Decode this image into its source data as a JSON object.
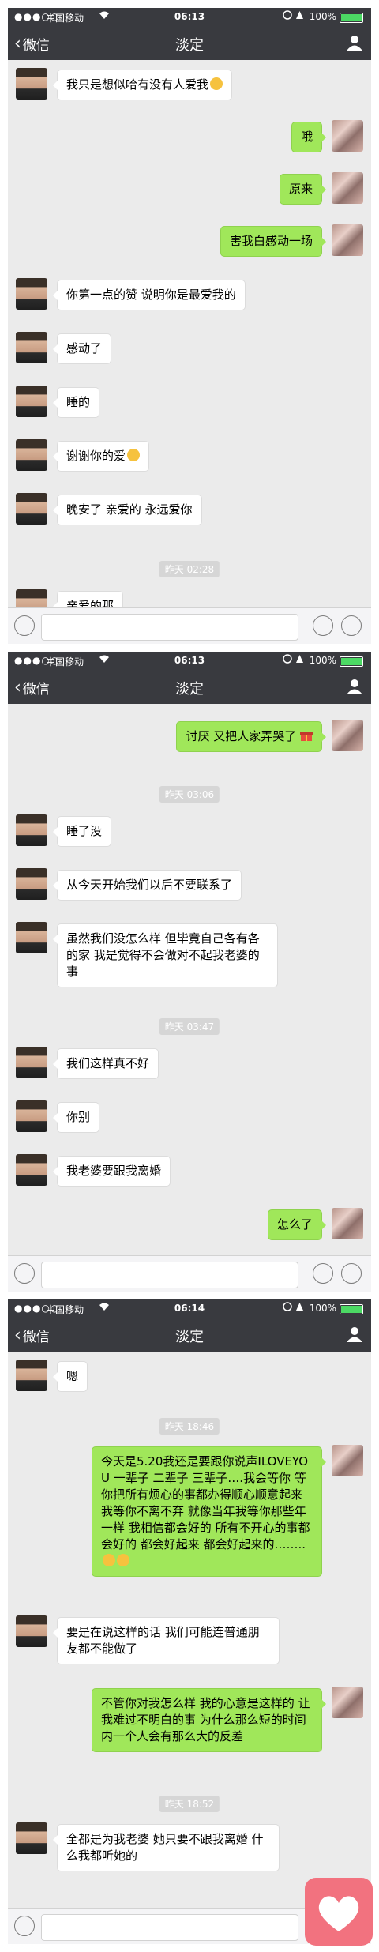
{
  "status": {
    "carrier": "中国移动",
    "battery": "100%",
    "signal_dots": "●●●○○"
  },
  "nav": {
    "back_label": "微信",
    "title": "淡定"
  },
  "panels": [
    {
      "time": "06:13",
      "messages": [
        {
          "side": "left",
          "text": "我只是想似哈有没有人爱我",
          "emoji": true
        },
        {
          "side": "right",
          "text": "哦"
        },
        {
          "side": "right",
          "text": "原来"
        },
        {
          "side": "right",
          "text": "害我白感动一场"
        },
        {
          "side": "left",
          "text": "你第一点的赞 说明你是最爱我的"
        },
        {
          "side": "left",
          "text": "感动了"
        },
        {
          "side": "left",
          "text": "睡的"
        },
        {
          "side": "left",
          "text": "谢谢你的爱",
          "emoji": true
        },
        {
          "side": "left",
          "text": "晚安了 亲爱的 永远爱你"
        }
      ],
      "timestamp": "昨天 02:28",
      "partial_message": "亲爱的那"
    },
    {
      "time": "06:13",
      "messages_a": [
        {
          "side": "right",
          "text": "讨厌 又把人家弄哭了",
          "gift": true
        }
      ],
      "timestamp_1": "昨天 03:06",
      "messages_b": [
        {
          "side": "left",
          "text": "睡了没"
        },
        {
          "side": "left",
          "text": "从今天开始我们以后不要联系了"
        },
        {
          "side": "left",
          "text": "虽然我们没怎么样 但毕竟自己各有各的家 我是觉得不会做对不起我老婆的事"
        }
      ],
      "timestamp_2": "昨天 03:47",
      "messages_c": [
        {
          "side": "left",
          "text": "我们这样真不好"
        },
        {
          "side": "left",
          "text": "你别"
        },
        {
          "side": "left",
          "text": "我老婆要跟我离婚"
        },
        {
          "side": "right",
          "text": "怎么了"
        }
      ]
    },
    {
      "time": "06:14",
      "messages_a": [
        {
          "side": "left",
          "text": "嗯"
        }
      ],
      "timestamp_1": "昨天 18:46",
      "messages_b": [
        {
          "side": "right",
          "text": "今天是5.20我还是要跟你说声ILOVEYOU 一辈子 二辈子 三辈子….我会等你 等你把所有烦心的事都办得顺心顺意起来 我等你不离不弃 就像当年我等你那些年一样 我相信都会好的 所有不开心的事都会好的 都会好起来 都会好起来的……..",
          "emoji2": true
        },
        {
          "side": "left",
          "text": "要是在说这样的话 我们可能连普通朋友都不能做了"
        },
        {
          "side": "right",
          "text": "不管你对我怎么样 我的心意是这样的 让我难过不明白的事 为什么那么短的时间内一个人会有那么大的反差"
        }
      ],
      "timestamp_2": "昨天 18:52",
      "messages_c": [
        {
          "side": "left",
          "text": "全都是为我老婆 她只要不跟我离婚 什么我都听她的"
        }
      ]
    }
  ]
}
